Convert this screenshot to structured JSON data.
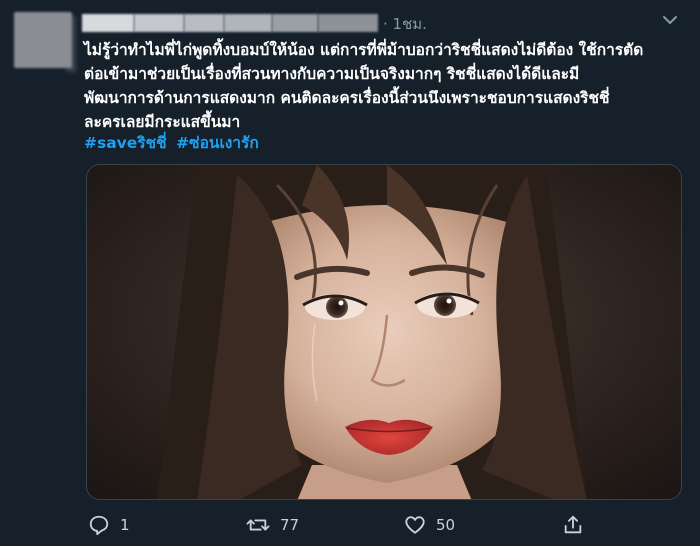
{
  "tweet": {
    "timestamp": "· 1ชม.",
    "text_lines": [
      "ไม่รู้ว่าทำไมพี่ไก่พูดทิ้งบอมบ์ให้น้อง แต่การที่พี่ม้าบอกว่าริชชี่แสดงไม่ดีต้อง ใช้การตัด",
      "ต่อเข้ามาช่วยเป็นเรื่องที่สวนทางกับความเป็นจริงมากๆ ริชชี่แสดงได้ดีและมี",
      "พัฒนาการด้านการแสดงมาก คนติดละครเรื่องนี้ส่วนนึงเพราะชอบการแสดงริชชี่",
      "ละครเลยมีกระแสขึ้นมา"
    ],
    "hashtags": [
      "#saveริชชี่",
      "#ซ่อนเงารัก"
    ],
    "media_description_icon": "photo",
    "actions": {
      "reply_count": "1",
      "retweet_count": "77",
      "like_count": "50"
    }
  },
  "colors": {
    "background": "#15202b",
    "text": "#ffffff",
    "secondary": "#8899a6",
    "link": "#1da1f2",
    "border": "#38444d"
  },
  "icons": {
    "more": "chevron-down-icon",
    "reply": "reply-icon",
    "retweet": "retweet-icon",
    "like": "heart-icon",
    "share": "share-icon"
  }
}
